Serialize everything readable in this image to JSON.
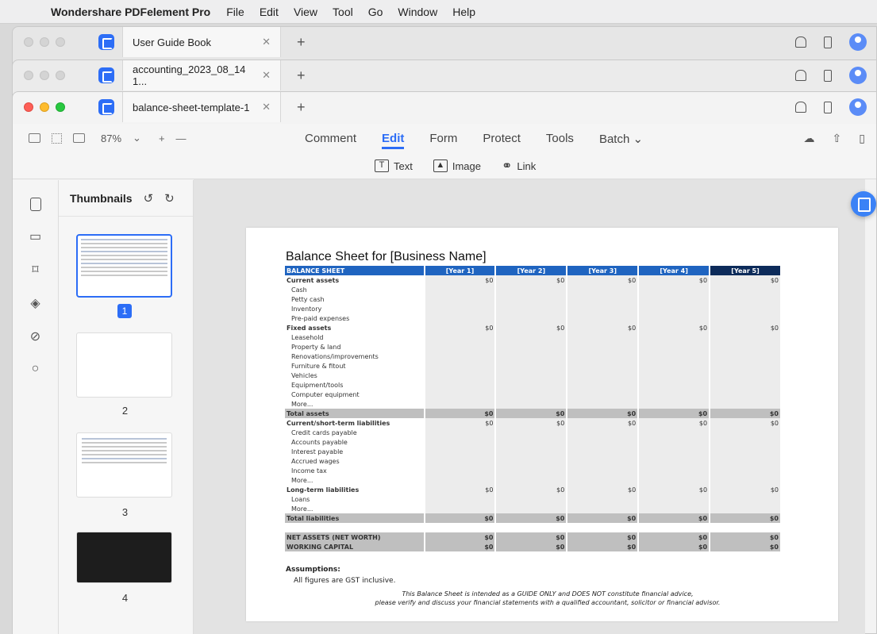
{
  "menubar": {
    "app_name": "Wondershare PDFelement Pro",
    "items": [
      "File",
      "Edit",
      "View",
      "Tool",
      "Go",
      "Window",
      "Help"
    ]
  },
  "windows": {
    "tab1": "User Guide Book",
    "tab2": "accounting_2023_08_14 1...",
    "tab3": "balance-sheet-template-1"
  },
  "toolbar": {
    "zoom": "87%",
    "menu": [
      "Comment",
      "Edit",
      "Form",
      "Protect",
      "Tools",
      "Batch"
    ],
    "sub": [
      "Text",
      "Image",
      "Link"
    ]
  },
  "sidebar": {
    "title": "Thumbnails",
    "pages": [
      "1",
      "2",
      "3",
      "4"
    ]
  },
  "document": {
    "title": "Balance Sheet for [Business Name]",
    "headers": [
      "BALANCE SHEET",
      "[Year 1]",
      "[Year 2]",
      "[Year 3]",
      "[Year 4]",
      "[Year 5]"
    ],
    "rows": [
      {
        "label": "Current assets",
        "type": "sec",
        "vals": [
          "$0",
          "$0",
          "$0",
          "$0",
          "$0"
        ]
      },
      {
        "label": "Cash",
        "type": "item",
        "vals": [
          "",
          "",
          "",
          "",
          ""
        ]
      },
      {
        "label": "Petty cash",
        "type": "item",
        "vals": [
          "",
          "",
          "",
          "",
          ""
        ]
      },
      {
        "label": "Inventory",
        "type": "item",
        "vals": [
          "",
          "",
          "",
          "",
          ""
        ]
      },
      {
        "label": "Pre-paid expenses",
        "type": "item",
        "vals": [
          "",
          "",
          "",
          "",
          ""
        ]
      },
      {
        "label": "Fixed assets",
        "type": "sec",
        "vals": [
          "$0",
          "$0",
          "$0",
          "$0",
          "$0"
        ]
      },
      {
        "label": "Leasehold",
        "type": "item",
        "vals": [
          "",
          "",
          "",
          "",
          ""
        ]
      },
      {
        "label": "Property & land",
        "type": "item",
        "vals": [
          "",
          "",
          "",
          "",
          ""
        ]
      },
      {
        "label": "Renovations/improvements",
        "type": "item",
        "vals": [
          "",
          "",
          "",
          "",
          ""
        ]
      },
      {
        "label": "Furniture & fitout",
        "type": "item",
        "vals": [
          "",
          "",
          "",
          "",
          ""
        ]
      },
      {
        "label": "Vehicles",
        "type": "item",
        "vals": [
          "",
          "",
          "",
          "",
          ""
        ]
      },
      {
        "label": "Equipment/tools",
        "type": "item",
        "vals": [
          "",
          "",
          "",
          "",
          ""
        ]
      },
      {
        "label": "Computer equipment",
        "type": "item",
        "vals": [
          "",
          "",
          "",
          "",
          ""
        ]
      },
      {
        "label": "More...",
        "type": "item",
        "vals": [
          "",
          "",
          "",
          "",
          ""
        ]
      },
      {
        "label": "Total assets",
        "type": "total",
        "vals": [
          "$0",
          "$0",
          "$0",
          "$0",
          "$0"
        ]
      },
      {
        "label": "Current/short-term liabilities",
        "type": "sec",
        "vals": [
          "$0",
          "$0",
          "$0",
          "$0",
          "$0"
        ]
      },
      {
        "label": "Credit cards payable",
        "type": "item",
        "vals": [
          "",
          "",
          "",
          "",
          ""
        ]
      },
      {
        "label": "Accounts payable",
        "type": "item",
        "vals": [
          "",
          "",
          "",
          "",
          ""
        ]
      },
      {
        "label": "Interest payable",
        "type": "item",
        "vals": [
          "",
          "",
          "",
          "",
          ""
        ]
      },
      {
        "label": "Accrued wages",
        "type": "item",
        "vals": [
          "",
          "",
          "",
          "",
          ""
        ]
      },
      {
        "label": "Income tax",
        "type": "item",
        "vals": [
          "",
          "",
          "",
          "",
          ""
        ]
      },
      {
        "label": "More...",
        "type": "item",
        "vals": [
          "",
          "",
          "",
          "",
          ""
        ]
      },
      {
        "label": "Long-term liabilities",
        "type": "sec",
        "vals": [
          "$0",
          "$0",
          "$0",
          "$0",
          "$0"
        ]
      },
      {
        "label": "Loans",
        "type": "item",
        "vals": [
          "",
          "",
          "",
          "",
          ""
        ]
      },
      {
        "label": "More...",
        "type": "item",
        "vals": [
          "",
          "",
          "",
          "",
          ""
        ]
      },
      {
        "label": "Total liabilities",
        "type": "total",
        "vals": [
          "$0",
          "$0",
          "$0",
          "$0",
          "$0"
        ]
      },
      {
        "label": "",
        "type": "blank",
        "vals": [
          "",
          "",
          "",
          "",
          ""
        ]
      },
      {
        "label": "NET ASSETS (NET WORTH)",
        "type": "total",
        "vals": [
          "$0",
          "$0",
          "$0",
          "$0",
          "$0"
        ]
      },
      {
        "label": "WORKING CAPITAL",
        "type": "total",
        "vals": [
          "$0",
          "$0",
          "$0",
          "$0",
          "$0"
        ]
      }
    ],
    "assumptions_title": "Assumptions:",
    "assumptions_text": "All figures are GST inclusive.",
    "disclaimer_1": "This Balance Sheet is intended as a GUIDE ONLY and DOES NOT constitute financial advice,",
    "disclaimer_2": "please verify and discuss your financial statements with a qualified accountant, solicitor or financial advisor."
  },
  "colors": {
    "accent": "#2c6df6",
    "header_blue": "#1f64c0",
    "header_dark": "#0d2b5a"
  }
}
